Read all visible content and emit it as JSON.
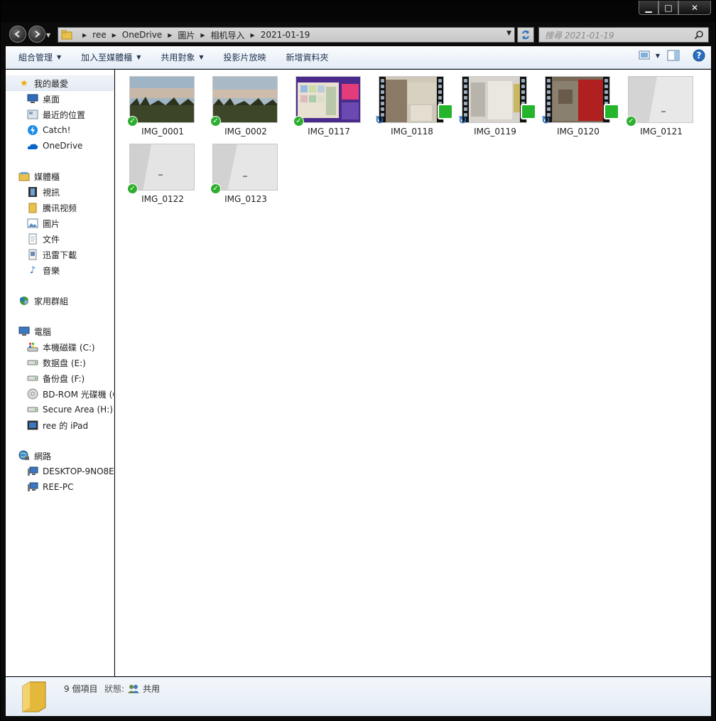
{
  "window": {
    "controls": {
      "minimize": "▁",
      "maximize": "□",
      "close": "✕"
    }
  },
  "address": {
    "crumbs": [
      "ree",
      "OneDrive",
      "圖片",
      "相机导入",
      "2021-01-19"
    ],
    "search_placeholder": "搜尋 2021-01-19"
  },
  "toolbar": {
    "organize": "組合管理",
    "add_to_library": "加入至媒體櫃",
    "share_with": "共用對象",
    "slideshow": "投影片放映",
    "new_folder": "新增資料夾"
  },
  "nav": {
    "favorites": {
      "label": "我的最愛",
      "items": [
        "桌面",
        "最近的位置",
        "Catch!",
        "OneDrive"
      ]
    },
    "libraries": {
      "label": "媒體櫃",
      "items": [
        "視訊",
        "騰讯视频",
        "圖片",
        "文件",
        "迅雷下載",
        "音樂"
      ]
    },
    "homegroup": {
      "label": "家用群組"
    },
    "computer": {
      "label": "電腦",
      "items": [
        "本機磁碟 (C:)",
        "数据盘 (E:)",
        "备份盘 (F:)",
        "BD-ROM 光碟機 (G",
        "Secure Area (H:)",
        "ree 的 iPad"
      ]
    },
    "network": {
      "label": "網路",
      "items": [
        "DESKTOP-9NO8E",
        "REE-PC"
      ]
    }
  },
  "files": [
    {
      "name": "IMG_0001",
      "kind": "photo-landscape",
      "status": "synced"
    },
    {
      "name": "IMG_0002",
      "kind": "photo-landscape",
      "status": "synced"
    },
    {
      "name": "IMG_0117",
      "kind": "photo-screenshot",
      "status": "synced"
    },
    {
      "name": "IMG_0118",
      "kind": "video",
      "status": "syncing"
    },
    {
      "name": "IMG_0119",
      "kind": "video",
      "status": "syncing"
    },
    {
      "name": "IMG_0120",
      "kind": "video",
      "status": "syncing"
    },
    {
      "name": "IMG_0121",
      "kind": "photo-wall",
      "status": "synced"
    },
    {
      "name": "IMG_0122",
      "kind": "photo-wall",
      "status": "synced"
    },
    {
      "name": "IMG_0123",
      "kind": "photo-wall",
      "status": "synced"
    }
  ],
  "details": {
    "count": "9 個項目",
    "state_label": "狀態:",
    "state_value": "共用"
  },
  "colors": {
    "accent": "#2a6fbf",
    "synced": "#2eae2e",
    "toolbar_text": "#1e3250"
  }
}
